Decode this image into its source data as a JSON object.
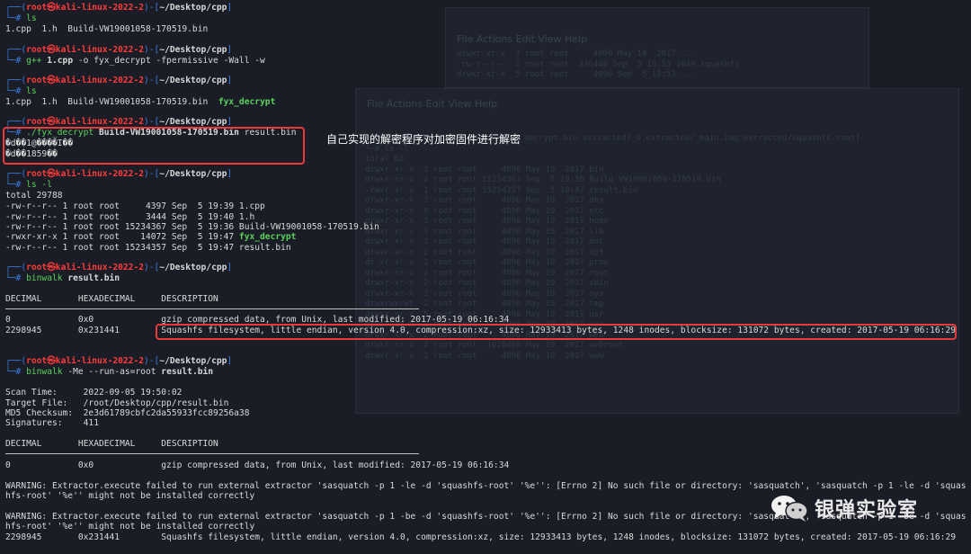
{
  "prompt": {
    "open": "┌──(",
    "user": "root㉿kali-linux-2022-2",
    "mid": ")-[",
    "dir": "~/Desktop/cpp",
    "close": "]",
    "hash": "└─#"
  },
  "lines": {
    "l2": "1.cpp  1.h  Build-VW19001058-170519.bin",
    "c3a": "g++",
    "c3b": " 1.cpp",
    "c3c": " -o fyx_decrypt -fpermissive -Wall -w",
    "c5": "ls",
    "l6a": "1.cpp  1.h  Build-VW19001058-170519.bin  ",
    "l6b": "fyx_decrypt",
    "c8a": "./fyx_decrypt",
    "c8b": " Build-VW19001058-170519.bin",
    "c8c": " result.bin",
    "l9": "�d��1@����I��",
    "l10": "�d��1859��",
    "c12": "ls -l",
    "l13": "total 29788",
    "ll": [
      "-rw-r--r-- 1 root root     4397 Sep  5 19:39 1.cpp",
      "-rw-r--r-- 1 root root     3444 Sep  5 19:40 1.h",
      "-rw-r--r-- 1 root root 15234367 Sep  5 19:36 Build-VW19001058-170519.bin"
    ],
    "ll4a": "-rwxr-xr-x 1 root root    14072 Sep  5 19:47 ",
    "ll4b": "fyx_decrypt",
    "ll5": "-rw-r--r-- 1 root root 15234357 Sep  5 19:47 result.bin",
    "c20a": "binwalk",
    "c20b": " result.bin",
    "hdr": "DECIMAL       HEXADECIMAL     DESCRIPTION",
    "r1": "0             0x0             gzip compressed data, from Unix, last modified: 2017-05-19 06:16:34",
    "r2": "2298945       0x231441        Squashfs filesystem, little endian, version 4.0, compression:xz, size: 12933413 bytes, 1248 inodes, blocksize: 131072 bytes, created: 2017-05-19 06:16:29",
    "c30a": "binwalk",
    "c30b": " -Me --run-as=root",
    "c30c": " result.bin",
    "s1": "Scan Time:     2022-09-05 19:50:02",
    "s2": "Target File:   /root/Desktop/cpp/result.bin",
    "s3": "MD5 Checksum:  2e3d61789cbfc2da55933fcc89256a38",
    "s4": "Signatures:    411",
    "hdr2": "DECIMAL       HEXADECIMAL     DESCRIPTION",
    "r3": "0             0x0             gzip compressed data, from Unix, last modified: 2017-05-19 06:16:34",
    "w1": "WARNING: Extractor.execute failed to run external extractor 'sasquatch -p 1 -le -d 'squashfs-root' '%e'': [Errno 2] No such file or directory: 'sasquatch', 'sasquatch -p 1 -le -d 'squas",
    "w1b": "hfs-root' '%e'' might not be installed correctly",
    "w2": "WARNING: Extractor.execute failed to run external extractor 'sasquatch -p 1 -be -d 'squashfs-root' '%e'': [Errno 2] No such file or directory: 'sasquatch', 'sasquatch -p 1 -be -d 'squas",
    "w2b": "hfs-root' '%e'' might not be installed correctly",
    "r4": "2298945       0x231441        Squashfs filesystem, little endian, version 4.0, compression:xz, size: 12933413 bytes, 1248 inodes, blocksize: 131072 bytes, created: 2017-05-19 06:16:29"
  },
  "annotation": "自己实现的解密程序对加密固件进行解密",
  "watermark": "银弹实验室",
  "colors": {
    "accent_red": "#e8393d",
    "prompt_blue": "#3d7de0",
    "cmd_green": "#5ad15a"
  }
}
